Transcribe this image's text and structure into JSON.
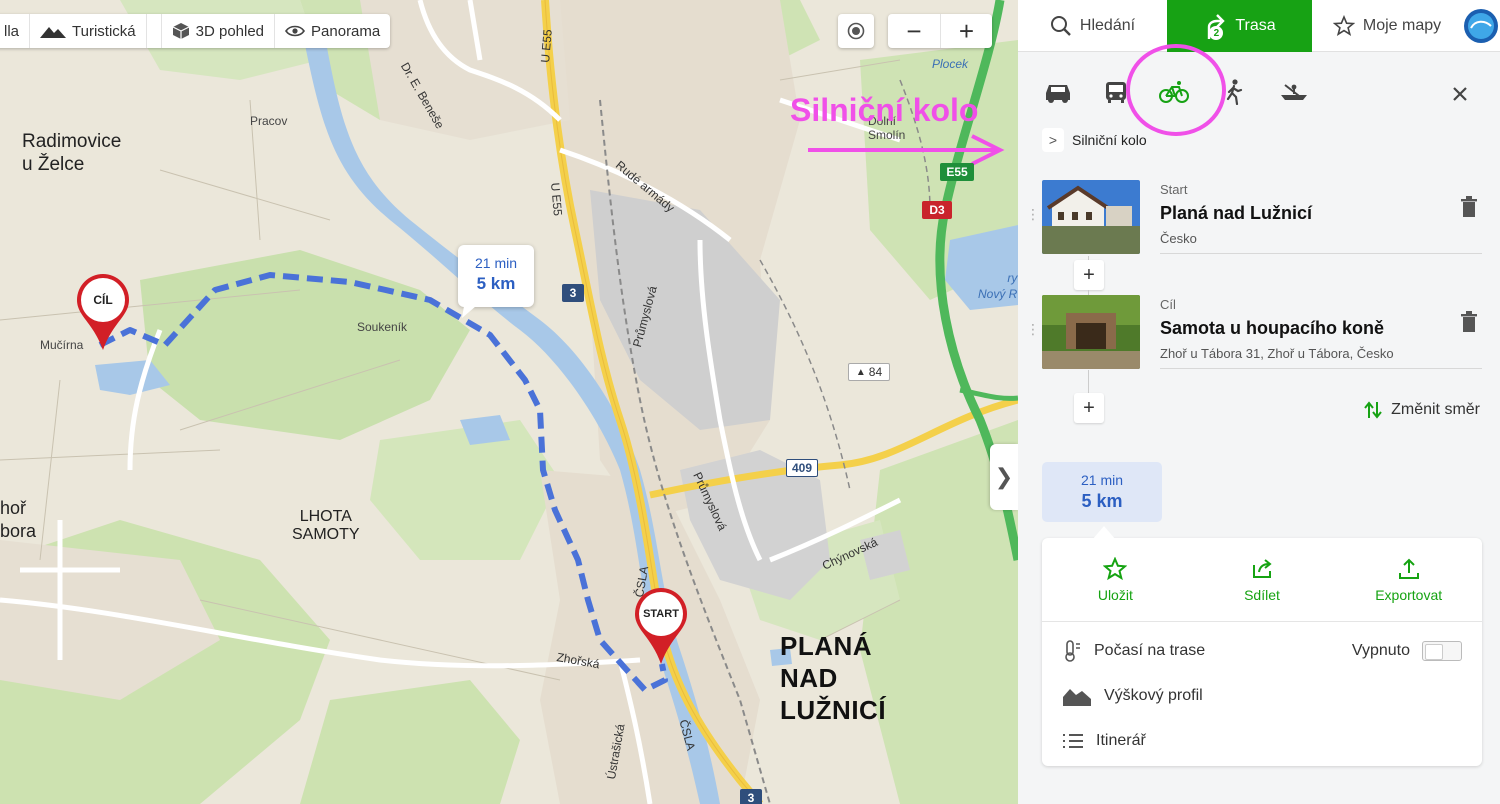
{
  "map": {
    "layer_control": {
      "cut_item": "lla",
      "turisticka": "Turistická",
      "pohled3d": "3D pohled",
      "panorama": "Panorama"
    },
    "zoom_out": "−",
    "zoom_in": "+",
    "labels": {
      "radimovice": "Radimovice\nu Želce",
      "pracov": "Pracov",
      "mucirna": "Mučírna",
      "soukenik": "Soukeník",
      "lhota_samoty": "LHOTA\nSAMOTY",
      "zhor_bora": "hoř\nbora",
      "plana": "PLANÁ\nNAD\nLUŽNICÍ",
      "dorf_smolin": "Dolní\nSmolín",
      "plocek": "Plocek",
      "novy_ryb": "ry\nNový R",
      "dr_benese": "Dr. E. Beneše",
      "rude_armady": "Rudé armády",
      "prumyslova1": "Průmyslová",
      "prumyslova2": "Průmyslová",
      "chynovska": "Chýnovská",
      "zhorska": "Zhořská",
      "ustrasicka": "Ústrašická",
      "csla1": "ČSLA",
      "csla2": "ČSLA",
      "ue55_a": "U E55",
      "ue55_b": "U E55",
      "n84": "84"
    },
    "road_badges": {
      "r3_top": "3",
      "r3_bottom": "3",
      "r409": "409",
      "e55": "E55",
      "d3": "D3"
    },
    "route_bubble": {
      "time": "21 min",
      "distance": "5 km"
    },
    "pin_start": "START",
    "pin_end": "CÍL",
    "annotation": "Silniční kolo",
    "colors": {
      "route": "#4a72d8",
      "annotation": "#f050e8",
      "pin": "#d21f26"
    }
  },
  "panel": {
    "tabs": {
      "search": "Hledání",
      "route": "Trasa",
      "mymaps": "Moje mapy"
    },
    "route_badge": "2",
    "breadcrumb": "Silniční kolo",
    "waypoints": [
      {
        "kind": "Start",
        "name": "Planá nad Lužnicí",
        "sub": "Česko"
      },
      {
        "kind": "Cíl",
        "name": "Samota u houpacího koně",
        "sub": "Zhoř u Tábora 31, Zhoř u Tábora, Česko"
      }
    ],
    "swap": "Změnit směr",
    "summary": {
      "time": "21 min",
      "distance": "5 km"
    },
    "actions": {
      "save": "Uložit",
      "share": "Sdílet",
      "export": "Exportovat"
    },
    "rows": {
      "weather": "Počasí na trase",
      "weather_state": "Vypnuto",
      "elevation": "Výškový profil",
      "itinerary": "Itinerář"
    },
    "colors": {
      "accent": "#17a214",
      "chip_bg": "#dfe7f7",
      "chip_text": "#2c5fc2"
    }
  }
}
